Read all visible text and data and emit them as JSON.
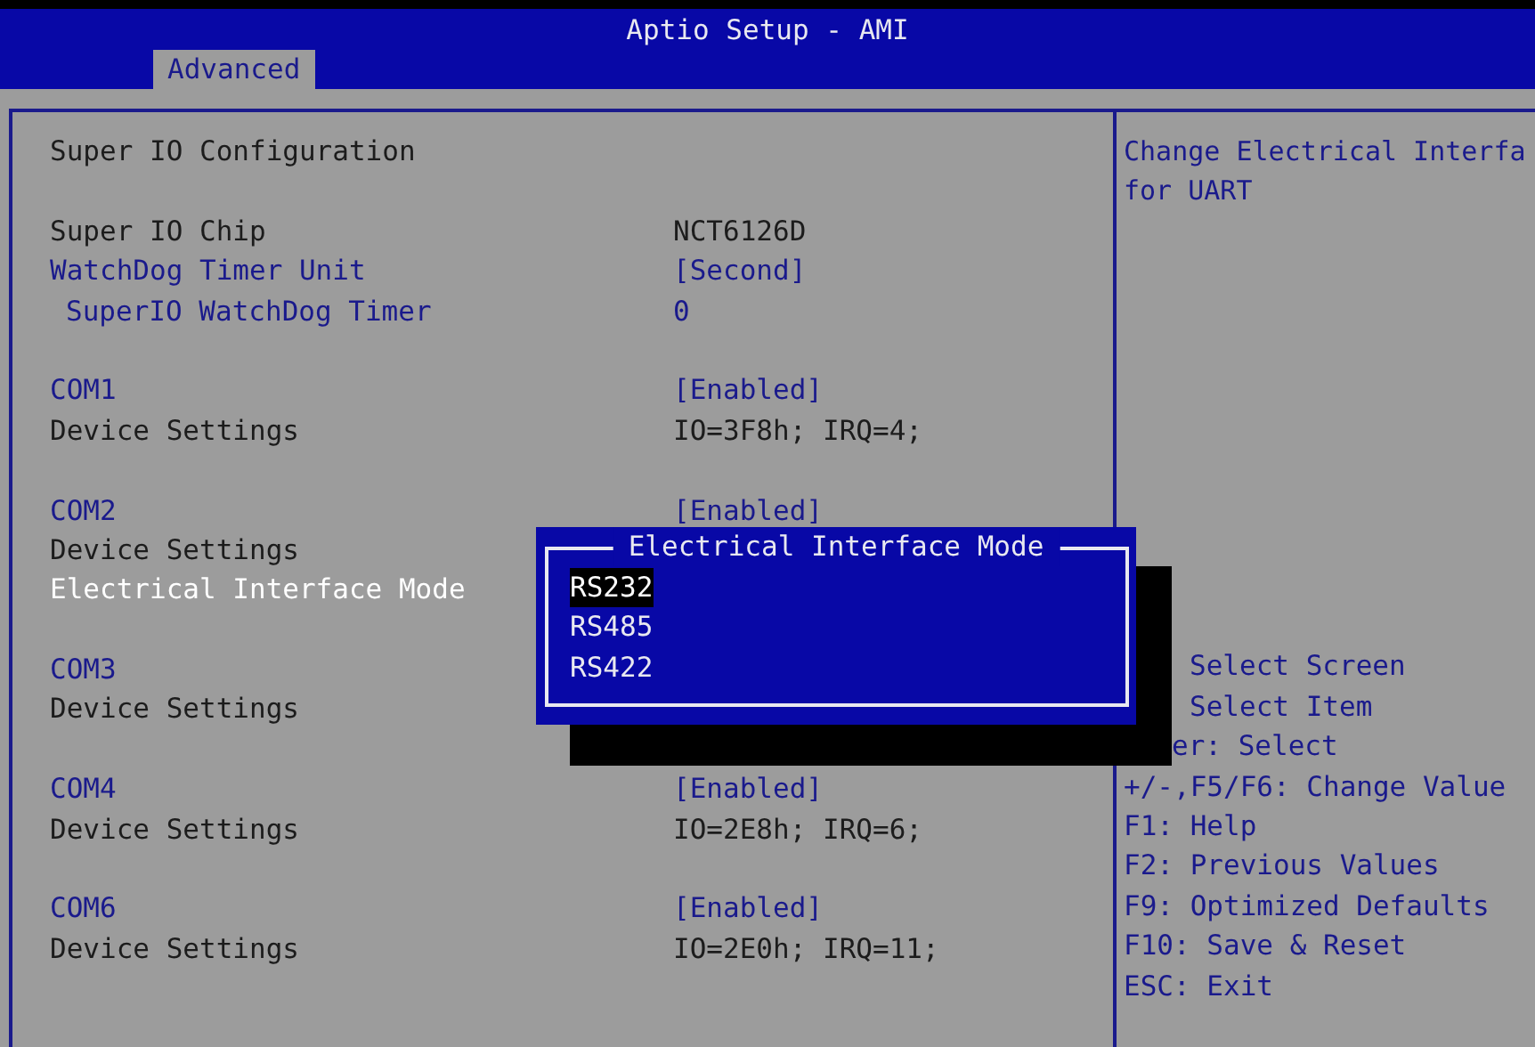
{
  "window": {
    "title": "Aptio Setup - AMI"
  },
  "tabs": [
    {
      "label": "Advanced",
      "selected": true
    }
  ],
  "settings": [
    [
      {
        "kind": "heading",
        "label": "Super IO Configuration"
      }
    ],
    [
      {
        "kind": "info",
        "label": "Super IO Chip",
        "value": "NCT6126D"
      },
      {
        "kind": "option",
        "label": "WatchDog Timer Unit",
        "value": "[Second]",
        "selected": false
      },
      {
        "kind": "suboption",
        "label": "SuperIO WatchDog Timer",
        "value": "0",
        "selected": false
      }
    ],
    [
      {
        "kind": "option",
        "label": "COM1",
        "value": "[Enabled]",
        "selected": false
      },
      {
        "kind": "info",
        "label": "Device Settings",
        "value": "IO=3F8h; IRQ=4;"
      }
    ],
    [
      {
        "kind": "option",
        "label": "COM2",
        "value": "[Enabled]",
        "selected": false
      },
      {
        "kind": "info",
        "label": "Device Settings"
      },
      {
        "kind": "option",
        "label": "Electrical Interface Mode",
        "selected": true
      }
    ],
    [
      {
        "kind": "option",
        "label": "COM3",
        "selected": false
      },
      {
        "kind": "info",
        "label": "Device Settings"
      }
    ],
    [
      {
        "kind": "option",
        "label": "COM4",
        "value": "[Enabled]",
        "selected": false
      },
      {
        "kind": "info",
        "label": "Device Settings",
        "value": "IO=2E8h; IRQ=6;"
      }
    ],
    [
      {
        "kind": "option",
        "label": "COM6",
        "value": "[Enabled]",
        "selected": false
      },
      {
        "kind": "info",
        "label": "Device Settings",
        "value": "IO=2E0h; IRQ=11;"
      }
    ]
  ],
  "help": {
    "description": [
      "Change Electrical Interfa",
      "for UART"
    ],
    "key_hints": [
      {
        "kind": "clipped",
        "text": "Select Screen"
      },
      {
        "kind": "clipped",
        "text": "Select Item"
      },
      {
        "kind": "clipped_short",
        "text": "er: Select"
      },
      {
        "kind": "full",
        "text": "+/-,F5/F6: Change Value"
      },
      {
        "kind": "full",
        "text": "F1: Help"
      },
      {
        "kind": "full",
        "text": "F2: Previous Values"
      },
      {
        "kind": "full",
        "text": "F9: Optimized Defaults"
      },
      {
        "kind": "full",
        "text": "F10: Save & Reset"
      },
      {
        "kind": "full",
        "text": "ESC: Exit"
      }
    ]
  },
  "popup": {
    "title": "Electrical Interface Mode",
    "options": [
      {
        "label": "RS232",
        "selected": true
      },
      {
        "label": "RS485",
        "selected": false
      },
      {
        "label": "RS422",
        "selected": false
      }
    ]
  }
}
